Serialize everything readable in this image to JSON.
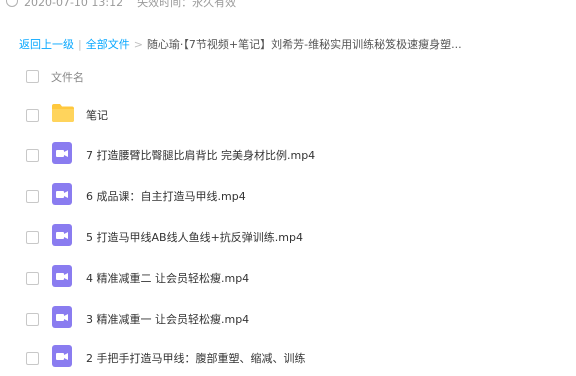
{
  "meta": {
    "share_date": "2020-07-10 13:12",
    "expiry": "失效时间：永久有效"
  },
  "breadcrumb": {
    "back": "返回上一级",
    "divider": "|",
    "all_files": "全部文件",
    "arrow": ">",
    "current": "随心瑜·【7节视频+笔记】刘希芳-维秘实用训练秘笈极速瘦身塑..."
  },
  "list": {
    "header": "文件名",
    "items": [
      {
        "name": "笔记",
        "type": "folder"
      },
      {
        "name": "7 打造腰臂比臀腿比肩背比 完美身材比例.mp4",
        "type": "video"
      },
      {
        "name": "6 成品课：自主打造马甲线.mp4",
        "type": "video"
      },
      {
        "name": "5 打造马甲线AB线人鱼线+抗反弹训练.mp4",
        "type": "video"
      },
      {
        "name": "4 精准减重二 让会员轻松瘦.mp4",
        "type": "video"
      },
      {
        "name": "3 精准减重一 让会员轻松瘦.mp4",
        "type": "video"
      },
      {
        "name": "2 手把手打造马甲线：腹部重塑、缩减、训练",
        "type": "video"
      }
    ]
  },
  "colors": {
    "link": "#06a7ff",
    "folder": "#ffc83d",
    "video": "#8a7cf0"
  }
}
